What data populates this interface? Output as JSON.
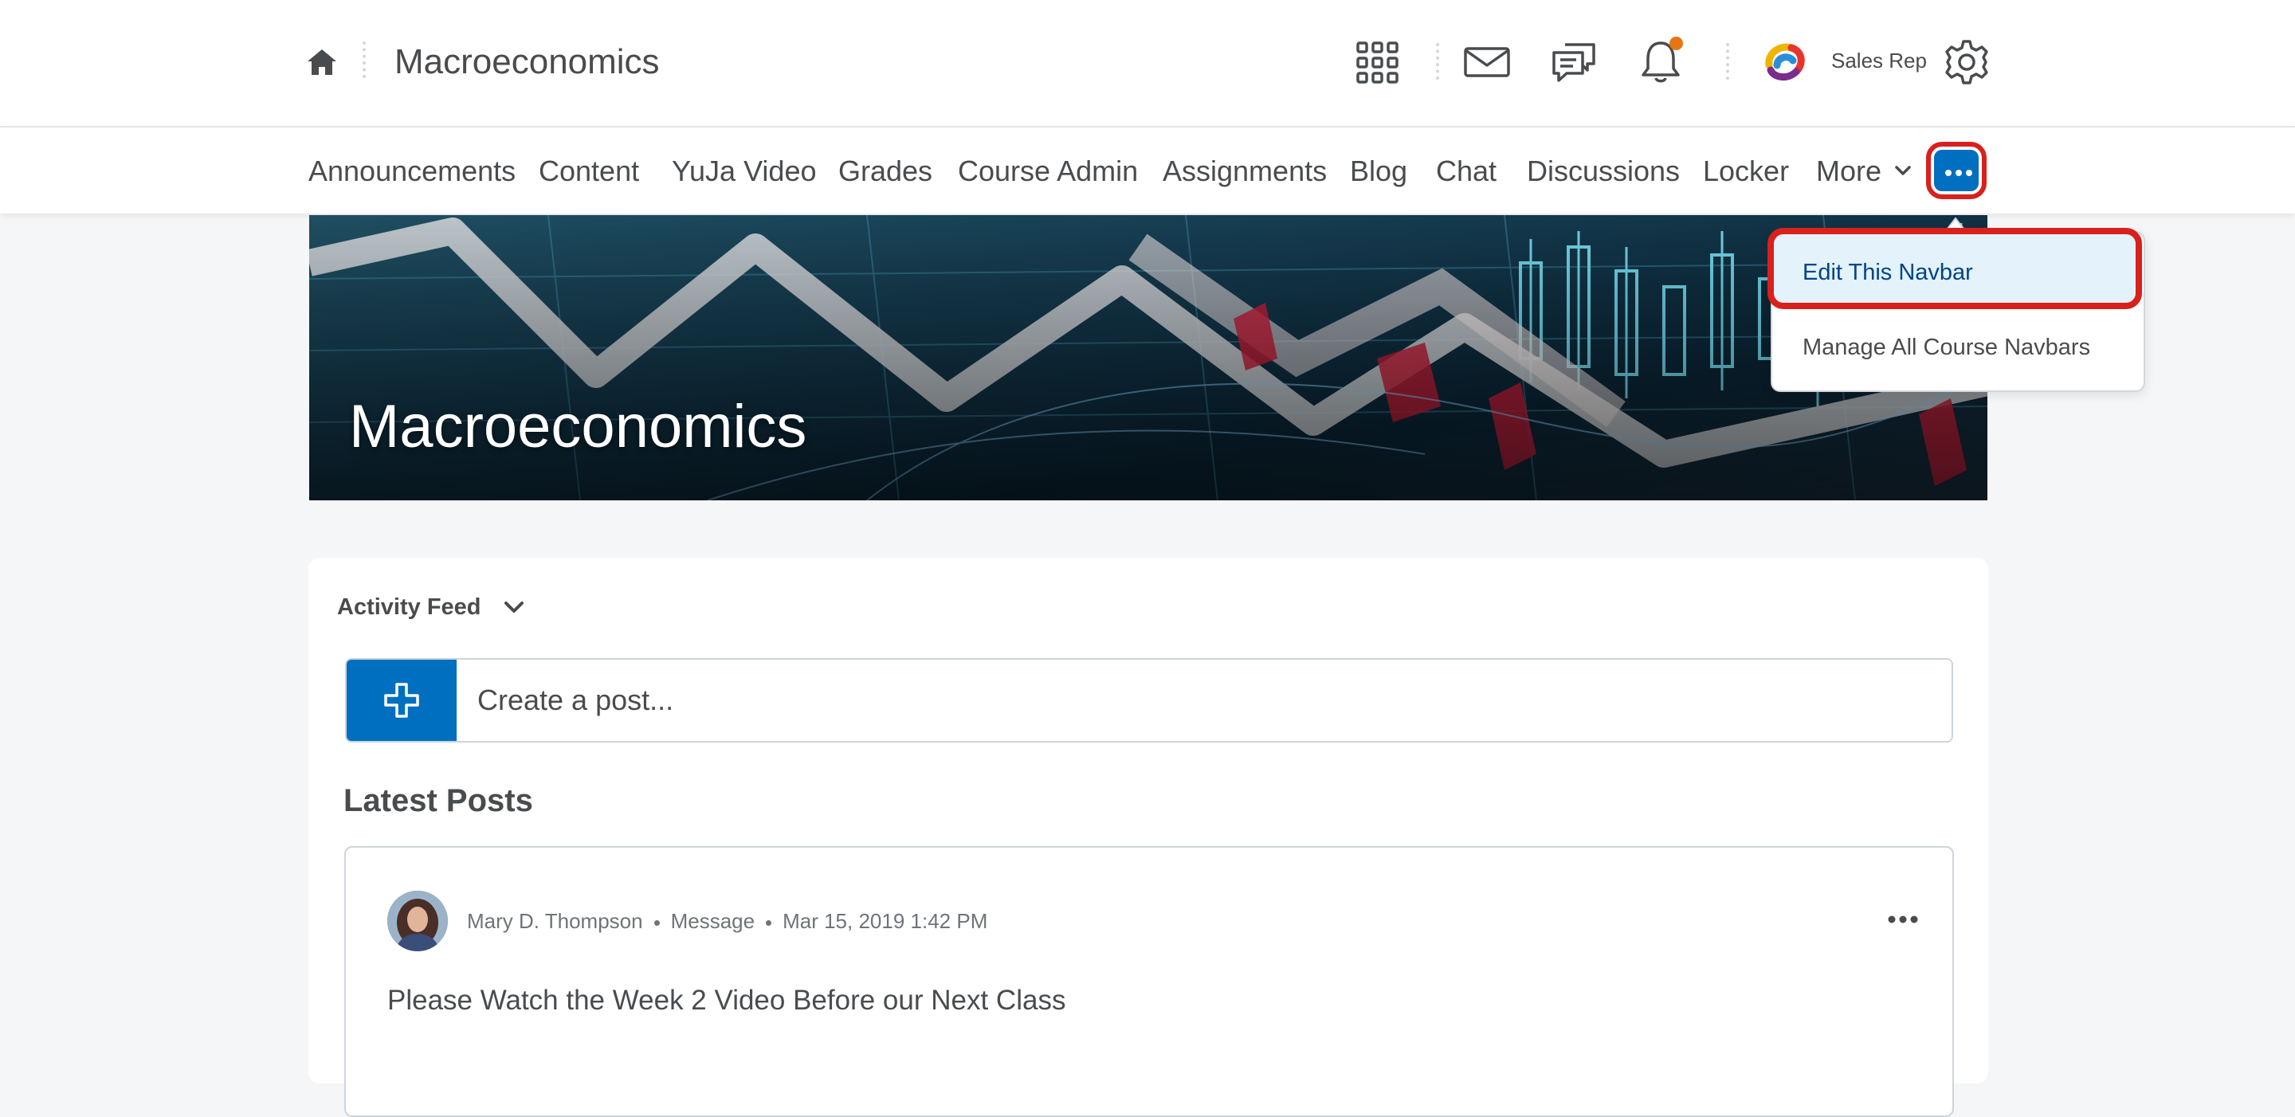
{
  "header": {
    "course_title": "Macroeconomics",
    "user_name": "Sales Rep",
    "icons": [
      "home-icon",
      "waffle-grid-icon",
      "mail-icon",
      "chat-bubbles-icon",
      "bell-icon",
      "org-logo-icon",
      "gear-icon"
    ],
    "notification_dot_color": "#e87511"
  },
  "navbar": {
    "items": [
      "Announcements",
      "Content",
      "YuJa Video",
      "Grades",
      "Course Admin",
      "Assignments",
      "Blog",
      "Chat",
      "Discussions",
      "Locker",
      "More"
    ],
    "overflow_icon": "ellipsis-icon",
    "accent_color": "#006fbf",
    "highlight_color": "#d9201c"
  },
  "dropdown": {
    "items": [
      "Edit This Navbar",
      "Manage All Course Navbars"
    ],
    "active_index": 0
  },
  "banner": {
    "title": "Macroeconomics"
  },
  "activity_feed": {
    "header": "Activity Feed",
    "create_placeholder": "Create a post...",
    "section_title": "Latest Posts",
    "posts": [
      {
        "author": "Mary D. Thompson",
        "type": "Message",
        "date": "Mar 15, 2019 1:42 PM",
        "title": "Please Watch the Week 2 Video Before our Next Class"
      }
    ]
  }
}
